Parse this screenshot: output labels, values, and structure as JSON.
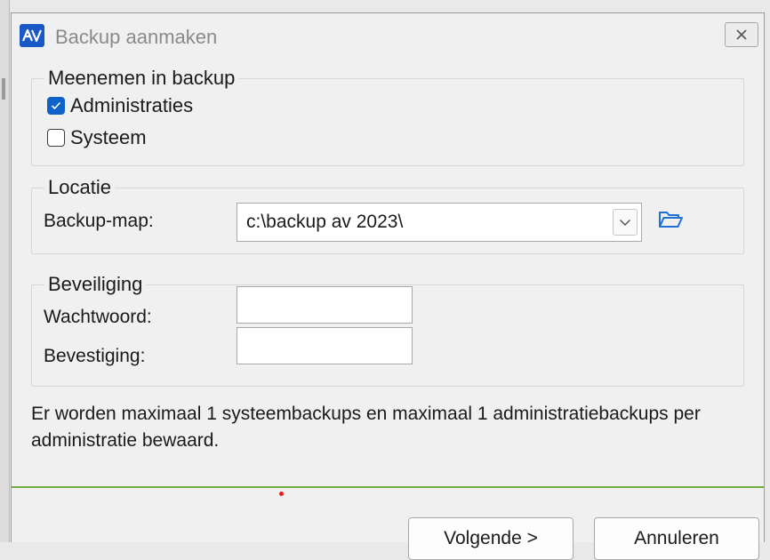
{
  "window": {
    "title": "Backup aanmaken",
    "logo_text": "AV",
    "close_glyph": "×"
  },
  "group_include": {
    "legend": "Meenemen in backup",
    "administraties": {
      "label": "Administraties",
      "checked": true
    },
    "systeem": {
      "label": "Systeem",
      "checked": false
    }
  },
  "group_location": {
    "legend": "Locatie",
    "backup_map_label": "Backup-map:",
    "backup_map_value": "c:\\backup av 2023\\",
    "icons": [
      "chevron-down-icon",
      "folder-open-icon"
    ]
  },
  "group_security": {
    "legend": "Beveiliging",
    "password_label": "Wachtwoord:",
    "password_value": "",
    "confirm_label": "Bevestiging:",
    "confirm_value": ""
  },
  "info_text": "Er worden maximaal 1 systeembackups en maximaal 1 administratiebackups per administratie bewaard.",
  "buttons": {
    "next": "Volgende >",
    "cancel": "Annuleren"
  },
  "colors": {
    "accent": "#0f62c8",
    "logo": "#1a57c7",
    "separator": "#6fae3e"
  }
}
